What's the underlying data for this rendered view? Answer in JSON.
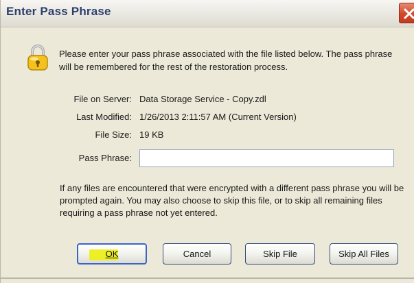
{
  "dialog": {
    "title": "Enter Pass Phrase",
    "message": "Please enter your pass phrase associated with the file listed below. The pass phrase will be remembered for the rest of the restoration process.",
    "fields": {
      "file_on_server": {
        "label": "File on Server:",
        "value": "Data Storage Service - Copy.zdl"
      },
      "last_modified": {
        "label": "Last Modified:",
        "value": "1/26/2013 2:11:57 AM (Current Version)"
      },
      "file_size": {
        "label": "File Size:",
        "value": "19 KB"
      }
    },
    "pass_phrase": {
      "label": "Pass Phrase:",
      "value": ""
    },
    "notice": "If any files are encountered that were encrypted with a different pass phrase you will be prompted again. You may also choose to skip this file, or to skip all remaining files requiring a pass phrase not yet entered.",
    "buttons": {
      "ok": "OK",
      "cancel": "Cancel",
      "skip_file": "Skip File",
      "skip_all_files": "Skip All Files"
    }
  },
  "icons": {
    "title_close": "close-icon",
    "lock": "padlock-icon"
  },
  "colors": {
    "title_text": "#2c3f6b",
    "close_button": "#d2482b",
    "dialog_background": "#ece9d8",
    "default_button_border": "#3a64c9",
    "highlight": "#ecef1c"
  }
}
